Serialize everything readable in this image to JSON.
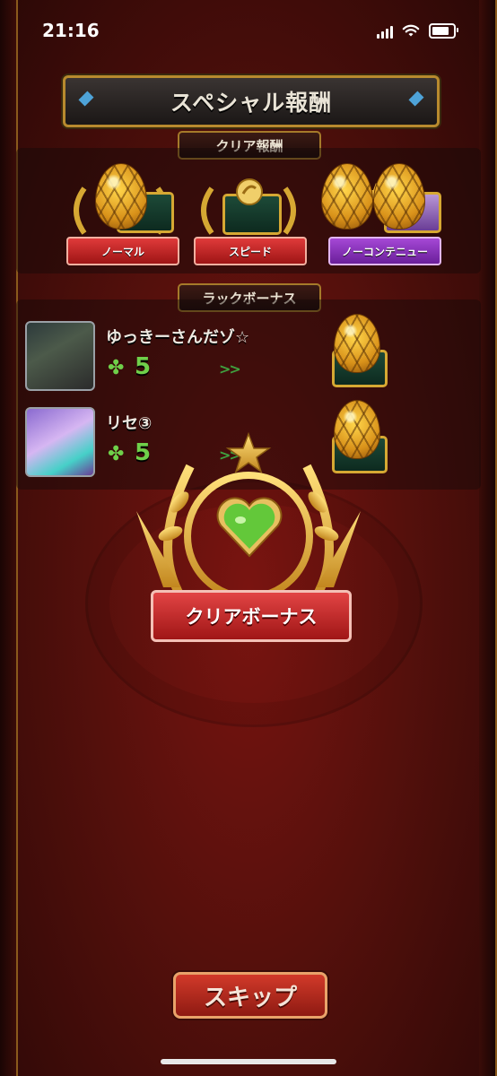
{
  "status_bar": {
    "time": "21:16"
  },
  "title": "スペシャル報酬",
  "clear_rewards": {
    "label": "クリア報酬",
    "items": [
      {
        "label": "ノーマル",
        "color": "#d02828"
      },
      {
        "label": "スピード",
        "color": "#d02828"
      },
      {
        "label": "ノーコンテニュー",
        "color": "#8a2ec0"
      }
    ]
  },
  "luck_bonus": {
    "label": "ラックボーナス",
    "rows": [
      {
        "name": "ゆっきーさんだゾ☆",
        "luck": "5",
        "arrows": ">>"
      },
      {
        "name": "リセ③",
        "luck": "5",
        "arrows": ">>"
      }
    ]
  },
  "clear_bonus": {
    "label": "クリアボーナス"
  },
  "skip_button": {
    "label": "スキップ"
  },
  "colors": {
    "gold": "#d6a833",
    "luck_green": "#6fd04a",
    "bg_red": "#7a1410"
  }
}
